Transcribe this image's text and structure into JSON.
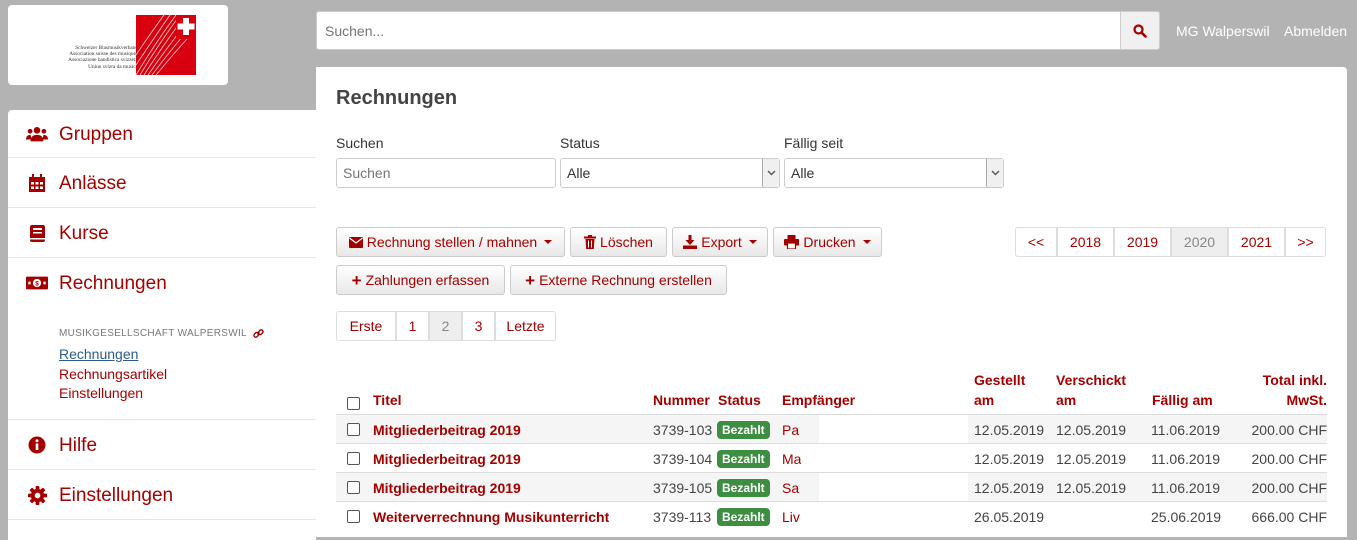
{
  "header": {
    "logo_lines": [
      "Schweizer Blasmusikverband",
      "Association suisse des musiques",
      "Associazione bandistica svizzera",
      "Uniun svizra da musica"
    ],
    "search_placeholder": "Suchen...",
    "group_link": "MG Walperswil",
    "logout_link": "Abmelden"
  },
  "sidebar": {
    "items": [
      {
        "label": "Gruppen",
        "icon": "users-icon"
      },
      {
        "label": "Anlässe",
        "icon": "calendar-icon"
      },
      {
        "label": "Kurse",
        "icon": "book-icon"
      },
      {
        "label": "Rechnungen",
        "icon": "money-bill-icon"
      },
      {
        "label": "Hilfe",
        "icon": "info-circle-icon"
      },
      {
        "label": "Einstellungen",
        "icon": "gear-icon"
      }
    ],
    "sub_heading": "MUSIKGESELLSCHAFT WALPERSWIL",
    "sub_links": [
      "Rechnungen",
      "Rechnungsartikel",
      "Einstellungen"
    ]
  },
  "main": {
    "title": "Rechnungen",
    "filters": {
      "search_label": "Suchen",
      "search_placeholder": "Suchen",
      "status_label": "Status",
      "status_value": "Alle",
      "due_label": "Fällig seit",
      "due_value": "Alle"
    },
    "buttons": {
      "send": "Rechnung stellen / mahnen",
      "delete": "Löschen",
      "export": "Export",
      "print": "Drucken",
      "payments": "Zahlungen erfassen",
      "external": "Externe Rechnung erstellen"
    },
    "year_nav": {
      "prev": "<<",
      "years": [
        "2018",
        "2019",
        "2020",
        "2021"
      ],
      "active_year": "2020",
      "next": ">>"
    },
    "pagination": {
      "first": "Erste",
      "pages": [
        "1",
        "2",
        "3"
      ],
      "active_page": "2",
      "last": "Letzte"
    },
    "table": {
      "headers": {
        "title": "Titel",
        "number": "Nummer",
        "status": "Status",
        "recipient": "Empfänger",
        "issued_1": "Gestellt",
        "issued_2": "am",
        "sent_1": "Verschickt",
        "sent_2": "am",
        "due": "Fällig am",
        "total_1": "Total inkl.",
        "total_2": "MwSt."
      },
      "rows": [
        {
          "title": "Mitgliederbeitrag 2019",
          "number": "3739-103",
          "status": "Bezahlt",
          "recipient": "Pa",
          "issued": "12.05.2019",
          "sent": "12.05.2019",
          "due": "11.06.2019",
          "total": "200.00 CHF"
        },
        {
          "title": "Mitgliederbeitrag 2019",
          "number": "3739-104",
          "status": "Bezahlt",
          "recipient": "Ma",
          "issued": "12.05.2019",
          "sent": "12.05.2019",
          "due": "11.06.2019",
          "total": "200.00 CHF"
        },
        {
          "title": "Mitgliederbeitrag 2019",
          "number": "3739-105",
          "status": "Bezahlt",
          "recipient": "Sa",
          "issued": "12.05.2019",
          "sent": "12.05.2019",
          "due": "11.06.2019",
          "total": "200.00 CHF"
        },
        {
          "title": "Weiterverrechnung Musikunterricht",
          "number": "3739-113",
          "status": "Bezahlt",
          "recipient": "Liv",
          "issued": "26.05.2019",
          "sent": "",
          "due": "25.06.2019",
          "total": "666.00 CHF"
        }
      ]
    }
  },
  "colors": {
    "brand_red": "#a50000",
    "badge_green": "#3e8e41",
    "background_gray": "#b3b3b3"
  }
}
